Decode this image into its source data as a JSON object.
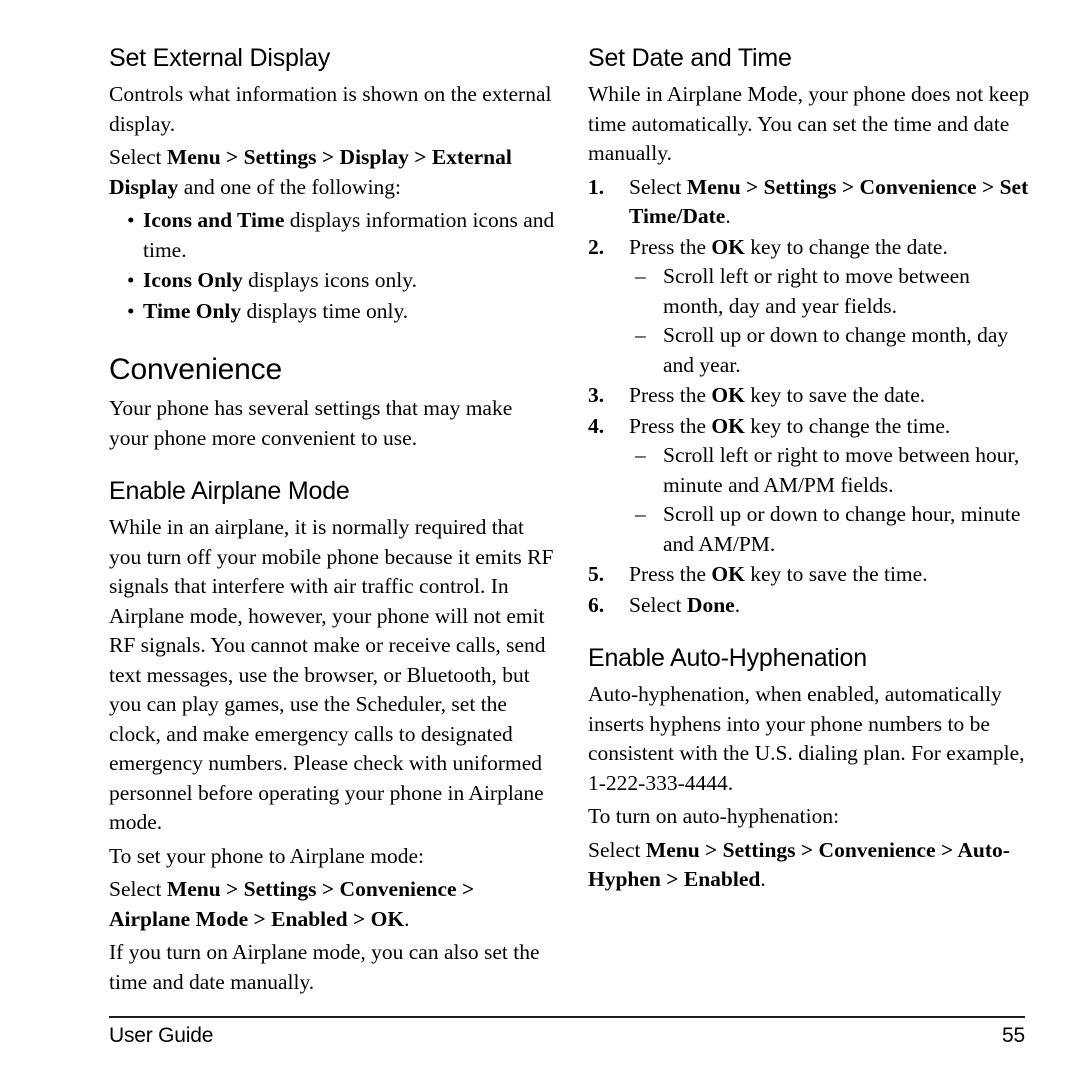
{
  "page": {
    "number": "55",
    "footer_label": "User Guide"
  },
  "left_column": {
    "set_external_display": {
      "heading": "Set External Display",
      "intro": "Controls what information is shown on the external display.",
      "select_line": {
        "lead": "Select ",
        "path": "Menu > Settings > Display > External Display",
        "tail": " and one of the following:"
      },
      "options": [
        {
          "bullet": "•",
          "term": "Icons and Time",
          "desc": " displays information icons and time."
        },
        {
          "bullet": "•",
          "term": "Icons Only",
          "desc": " displays icons only."
        },
        {
          "bullet": "•",
          "term": "Time Only",
          "desc": " displays time only."
        }
      ]
    },
    "convenience": {
      "heading": "Convenience",
      "intro": "Your phone has several settings that may make your phone more convenient to use."
    },
    "enable_airplane_mode": {
      "heading": "Enable Airplane Mode",
      "paragraph": "While in an airplane, it is normally required that you turn off your mobile phone because it emits RF signals that interfere with air traffic control. In Airplane mode, however, your phone will not emit RF signals. You cannot make or receive calls, send text messages, use the browser, or Bluetooth, but you can play games, use the Scheduler, set the clock, and make emergency calls to designated emergency numbers. Please check with uniformed personnel before operating your phone in Airplane mode.",
      "lead_in": "To set your phone to Airplane mode:",
      "select_line": {
        "lead": "Select ",
        "path": "Menu > Settings > Convenience > Airplane Mode > Enabled > OK",
        "tail": "."
      },
      "closing": "If you turn on Airplane mode, you can also set the time and date manually."
    }
  },
  "right_column": {
    "set_date_and_time": {
      "heading": "Set Date and Time",
      "intro": "While in Airplane Mode, your phone does not keep time automatically. You can set the time and date manually.",
      "steps": [
        {
          "num": "1.",
          "lead": "Select ",
          "path": "Menu  > Settings > Convenience > Set Time/Date",
          "tail": ".",
          "subs": []
        },
        {
          "num": "2.",
          "lead": "Press the ",
          "path": "OK",
          "tail": " key to change the date.",
          "subs": [
            {
              "dash": "–",
              "text": "Scroll left or right to move between month, day and year fields."
            },
            {
              "dash": "–",
              "text": "Scroll up or down to change month, day and year."
            }
          ]
        },
        {
          "num": "3.",
          "lead": "Press the ",
          "path": "OK",
          "tail": " key to save the date.",
          "subs": []
        },
        {
          "num": "4.",
          "lead": "Press the ",
          "path": "OK",
          "tail": " key to change the time.",
          "subs": [
            {
              "dash": "–",
              "text": "Scroll left or right to move between hour, minute and AM/PM fields."
            },
            {
              "dash": "–",
              "text": "Scroll up or down to change hour, minute and AM/PM."
            }
          ]
        },
        {
          "num": "5.",
          "lead": "Press the ",
          "path": "OK",
          "tail": " key to save the time.",
          "subs": []
        },
        {
          "num": "6.",
          "lead": "Select ",
          "path": "Done",
          "tail": ".",
          "subs": []
        }
      ]
    },
    "enable_auto_hyphenation": {
      "heading": "Enable Auto-Hyphenation",
      "paragraph": "Auto-hyphenation, when enabled, automatically inserts hyphens into your phone numbers to be consistent with the U.S. dialing plan. For example, 1-222-333-4444.",
      "lead_in": "To turn on auto-hyphenation:",
      "select_line": {
        "lead": "Select ",
        "path": "Menu > Settings > Convenience > Auto-Hyphen > Enabled",
        "tail": "."
      }
    }
  }
}
